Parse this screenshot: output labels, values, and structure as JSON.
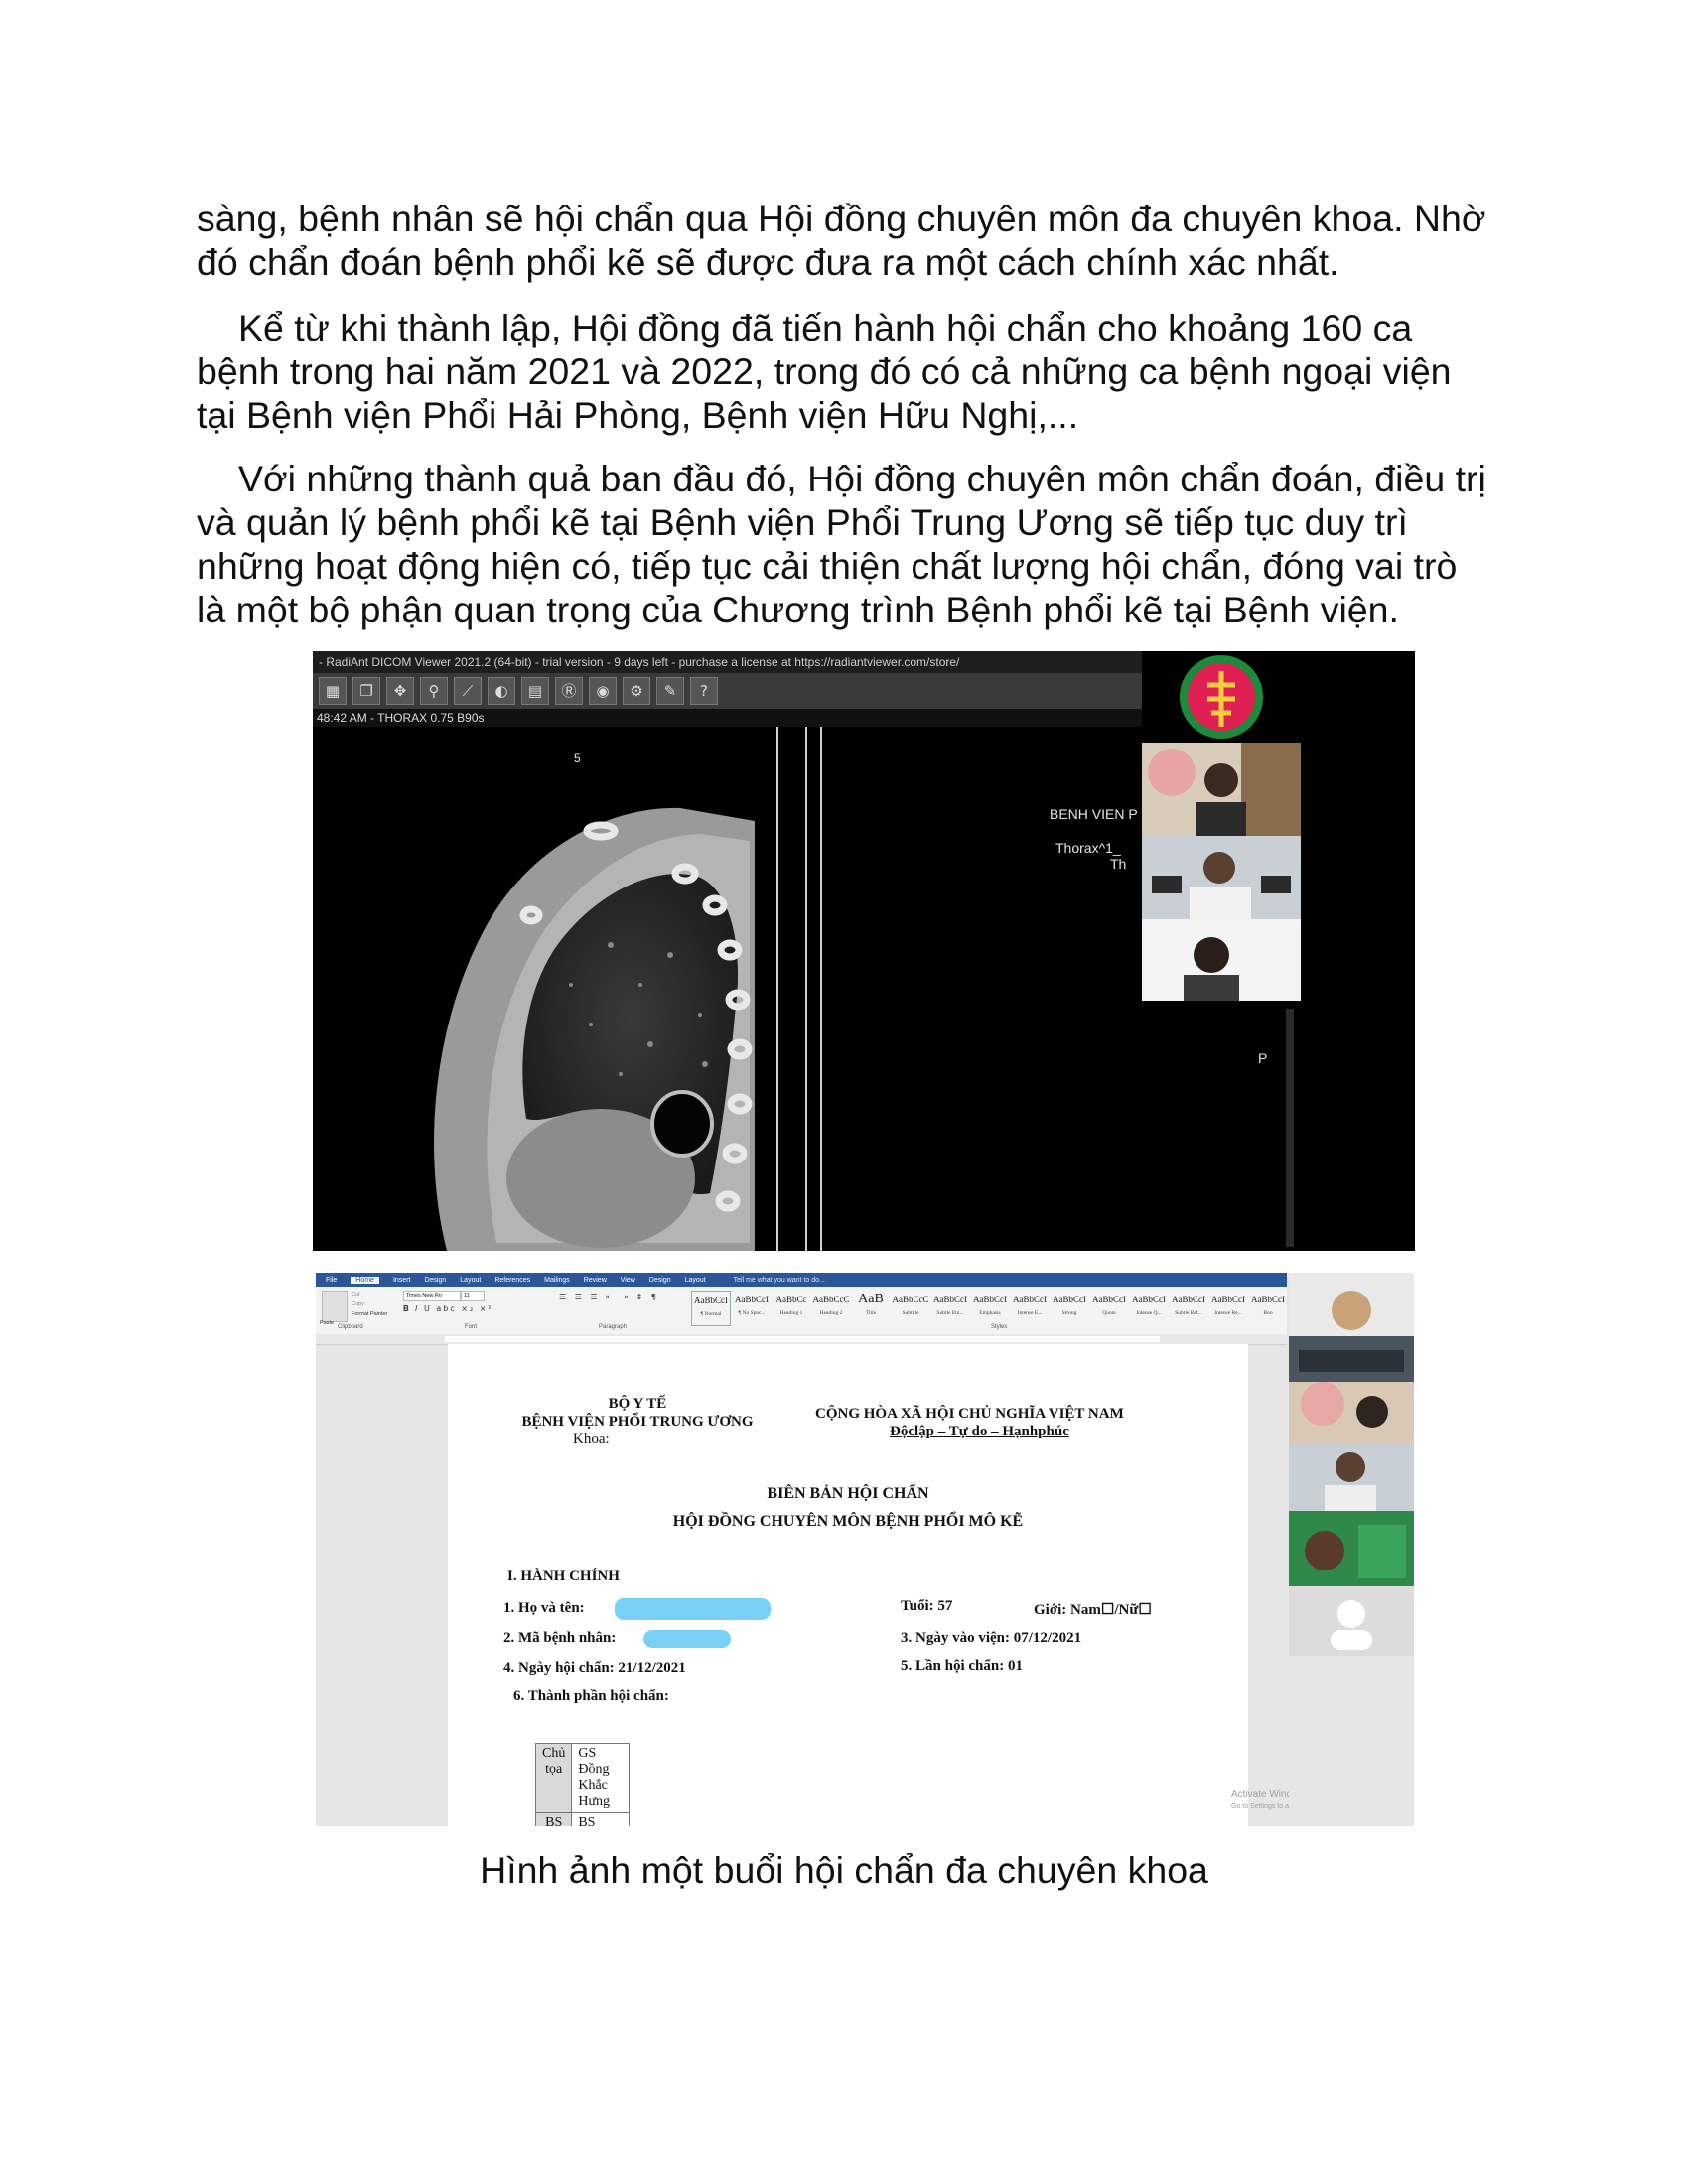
{
  "paragraphs": {
    "p1": "sàng, bệnh nhân sẽ hội chẩn qua Hội đồng chuyên môn đa chuyên khoa. Nhờ đó chẩn đoán bệnh phổi kẽ sẽ được đưa ra một cách chính xác nhất.",
    "p2": "Kể từ khi thành lập, Hội đồng đã tiến hành hội chẩn cho khoảng 160 ca bệnh trong hai năm 2021 và 2022, trong đó có cả những ca bệnh ngoại viện tại Bệnh viện Phổi Hải Phòng, Bệnh viện Hữu Nghị,...",
    "p3": "Với những thành quả ban đầu đó, Hội đồng chuyên môn chẩn đoán, điều trị và quản lý bệnh phổi kẽ tại Bệnh viện Phổi Trung Ương sẽ tiếp tục duy trì những hoạt động hiện có, tiếp tục cải thiện chất lượng hội chẩn, đóng vai trò là một bộ phận quan trọng của Chương trình Bệnh phổi kẽ tại Bệnh viện."
  },
  "dicom": {
    "title_bar": "- RadiAnt DICOM Viewer 2021.2 (64-bit) - trial version - 9 days left - purchase a license at https://radiantviewer.com/store/",
    "info_bar": "48:42 AM - THORAX  0.75  B90s",
    "overlay_hospital": "BENH VIEN P",
    "overlay_series": "Thorax^1_",
    "overlay_series_2": "Th",
    "overlay_orientation": "P",
    "marker": "5"
  },
  "word": {
    "tabs": [
      "File",
      "Home",
      "Insert",
      "Design",
      "Layout",
      "References",
      "Mailings",
      "Review",
      "View",
      "Design",
      "Layout"
    ],
    "tell_me": "Tell me what you want to do...",
    "font_name": "Times New Ro",
    "font_size": "11",
    "styles": [
      {
        "sample": "AaBbCcI",
        "name": "¶ Normal"
      },
      {
        "sample": "AaBbCcI",
        "name": "¶ No Spac..."
      },
      {
        "sample": "AaBbCc",
        "name": "Heading 1"
      },
      {
        "sample": "AaBbCcC",
        "name": "Heading 2"
      },
      {
        "sample": "AaB",
        "name": "Title"
      },
      {
        "sample": "AaBbCcC",
        "name": "Subtitle"
      },
      {
        "sample": "AaBbCcI",
        "name": "Subtle Em..."
      },
      {
        "sample": "AaBbCcI",
        "name": "Emphasis"
      },
      {
        "sample": "AaBbCcI",
        "name": "Intense E..."
      },
      {
        "sample": "AaBbCcI",
        "name": "Strong"
      },
      {
        "sample": "AaBbCcI",
        "name": "Quote"
      },
      {
        "sample": "AaBbCcI",
        "name": "Intense Q..."
      },
      {
        "sample": "AaBbCcI",
        "name": "Subtle Ref..."
      },
      {
        "sample": "AaBbCcI",
        "name": "Intense Re..."
      },
      {
        "sample": "AaBbCcI",
        "name": "Boo"
      }
    ],
    "groups": {
      "clipboard": "Clipboard",
      "font": "Font",
      "paragraph": "Paragraph",
      "styles": "Styles"
    },
    "clipboard": {
      "paste": "Paste",
      "cut": "Cut",
      "copy": "Copy",
      "format_painter": "Format Painter"
    },
    "doc": {
      "ministry": "BỘ Y TẾ",
      "hospital": "BỆNH VIỆN PHỔI TRUNG ƯƠNG",
      "department": "Khoa:",
      "republic": "CỘNG HÒA XÃ HỘI CHỦ NGHĨA VIỆT NAM",
      "motto": "Độclập – Tự do – Hạnhphúc",
      "title1": "BIÊN BẢN HỘI CHẨN",
      "title2": "HỘI ĐỒNG CHUYÊN MÔN BỆNH PHỔI MÔ KẼ",
      "section1": "I. HÀNH CHÍNH",
      "f_name": "1. Họ và tên:",
      "f_age": "Tuổi: 57",
      "f_gender": "Giới: Nam☐/Nữ☐",
      "f_patient_id": "2. Mã bệnh nhân:",
      "f_admission": "3. Ngày vào viện: 07/12/2021",
      "f_consult_date": "4. Ngày hội chẩn: 21/12/2021",
      "f_consult_count": "5. Lần hội chẩn: 01",
      "f_members": "6. Thành phần hội chẩn:",
      "table": [
        {
          "role": "Chủ tọa",
          "members": "GS Đồng Khắc Hưng"
        },
        {
          "role": "BS Hô hấp",
          "members": "BS Nguyễn Thị Bích Ngọc, BS Lê Ngọc Huy, BS Trịnh Thị Hằng, BS Phạm Văn Đoàn"
        }
      ]
    },
    "activate_title": "Activate Windows",
    "activate_sub": "Go to Settings to activate Windows."
  },
  "caption": "Hình ảnh một buổi hội chẩn đa chuyên khoa"
}
